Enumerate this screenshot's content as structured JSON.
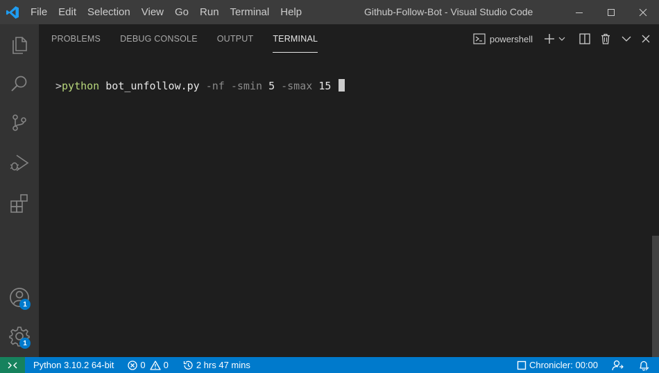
{
  "titlebar": {
    "menu": [
      "File",
      "Edit",
      "Selection",
      "View",
      "Go",
      "Run",
      "Terminal",
      "Help"
    ],
    "window_title": "Github-Follow-Bot - Visual Studio Code"
  },
  "activity_badges": {
    "accounts": "1",
    "manage": "1"
  },
  "panel": {
    "tabs": [
      "PROBLEMS",
      "DEBUG CONSOLE",
      "OUTPUT",
      "TERMINAL"
    ],
    "active_tab": "TERMINAL",
    "shell": "powershell"
  },
  "terminal": {
    "prompt": ">",
    "command": "python",
    "script": "bot_unfollow.py",
    "flag1": "-nf",
    "flag2": "-smin",
    "value1": "5",
    "flag3": "-smax",
    "value2": "15"
  },
  "statusbar": {
    "python": "Python 3.10.2 64-bit",
    "errors": "0",
    "warnings": "0",
    "time": "2 hrs 47 mins",
    "chronicler": "Chronicler: 00:00"
  },
  "colors": {
    "titlebar": "#3c3c3c",
    "activitybar": "#333333",
    "panel": "#1e1e1e",
    "statusbar": "#007acc",
    "remote": "#16825d",
    "vscode_blue": "#1f9cf0"
  }
}
